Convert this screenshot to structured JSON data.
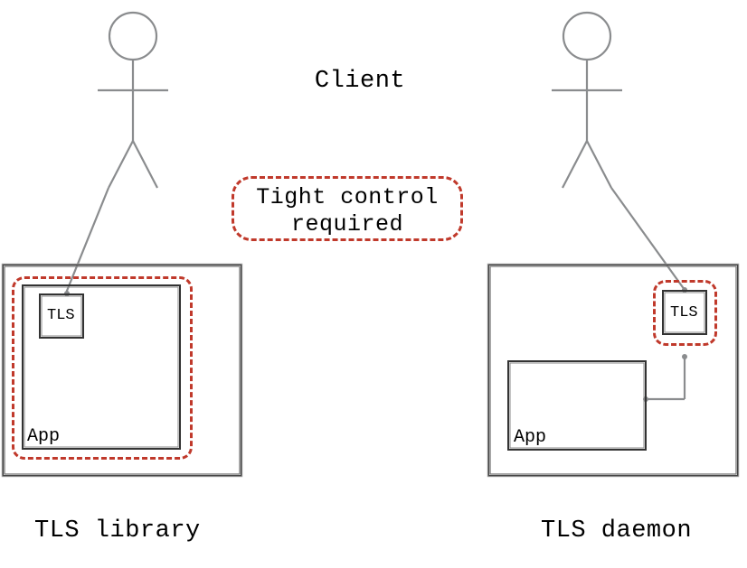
{
  "title": "Client",
  "callout": {
    "line1": "Tight control",
    "line2": "required"
  },
  "left": {
    "caption": "TLS library",
    "app": "App",
    "tls": "TLS"
  },
  "right": {
    "caption": "TLS daemon",
    "app": "App",
    "tls": "TLS"
  }
}
